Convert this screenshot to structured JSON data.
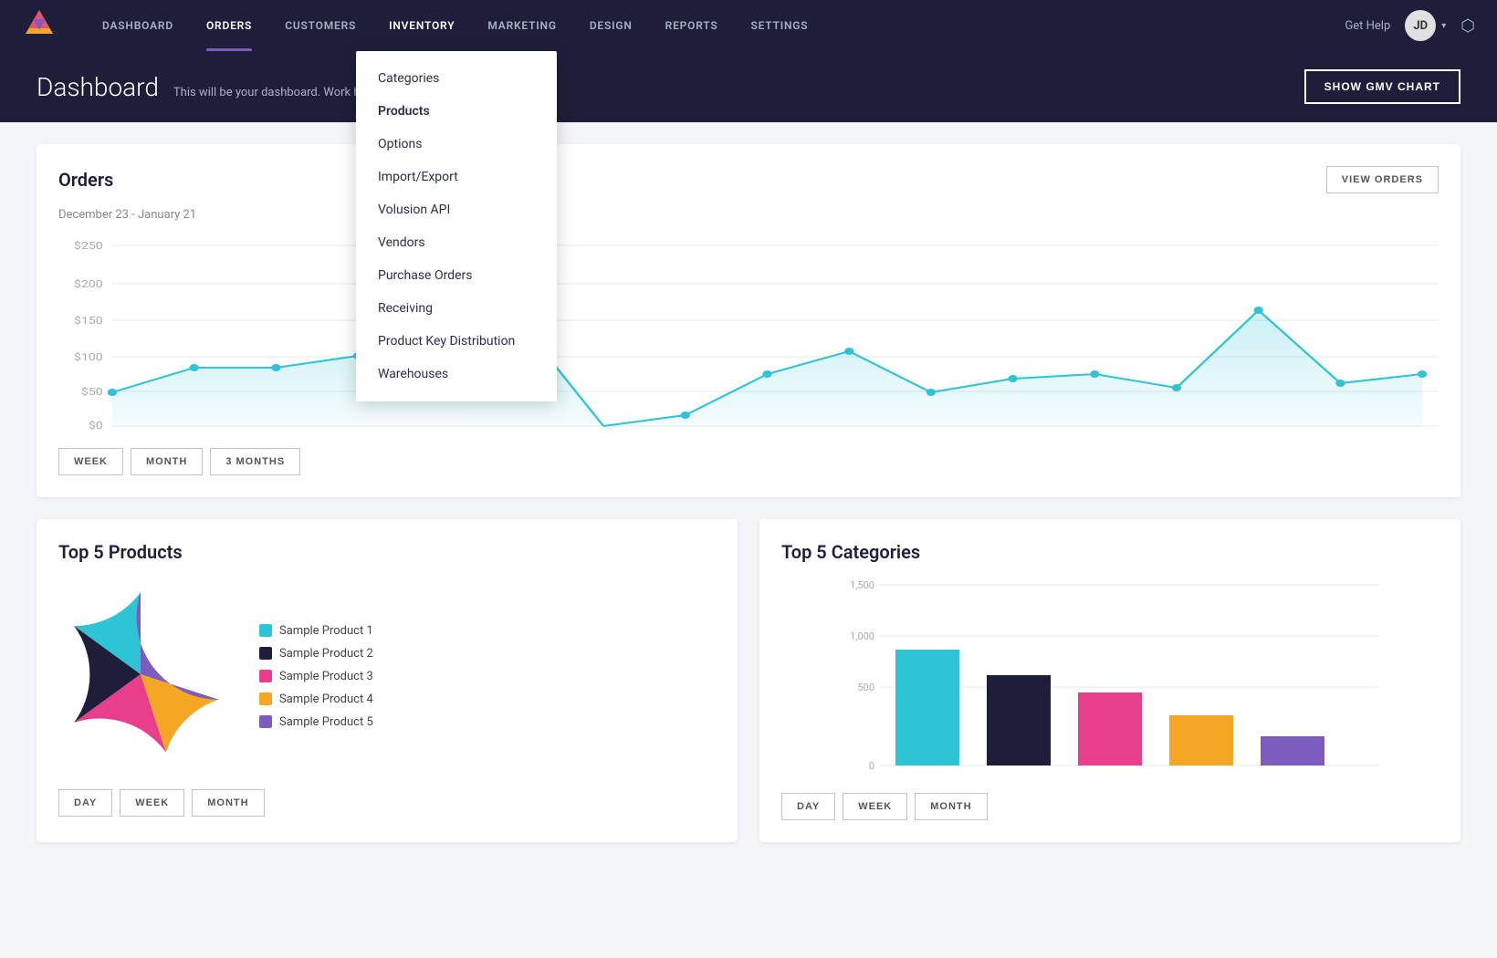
{
  "nav": {
    "items": [
      {
        "id": "dashboard",
        "label": "DASHBOARD",
        "active": false
      },
      {
        "id": "orders",
        "label": "ORDERS",
        "active": true
      },
      {
        "id": "customers",
        "label": "CUSTOMERS",
        "active": false
      },
      {
        "id": "inventory",
        "label": "INVENTORY",
        "active": false,
        "highlighted": true
      },
      {
        "id": "marketing",
        "label": "MARKETING",
        "active": false
      },
      {
        "id": "design",
        "label": "DESIGN",
        "active": false
      },
      {
        "id": "reports",
        "label": "REPORTS",
        "active": false
      },
      {
        "id": "settings",
        "label": "SETTINGS",
        "active": false
      }
    ],
    "get_help": "Get Help",
    "avatar_initials": "JD",
    "external_link_char": "⬡"
  },
  "header": {
    "title": "Dashboard",
    "subtitle": "This will be your dashboard. W...",
    "subtitle_full": "This will be your dashboard. Work hard and you'll get your first sale.",
    "gmv_button": "SHOW GMV CHART"
  },
  "orders_card": {
    "title": "Orders",
    "view_orders_btn": "VIEW ORDERS",
    "date_range": "December 23 - January 21",
    "y_labels": [
      "$250",
      "$200",
      "$150",
      "$100",
      "$50",
      "$0"
    ],
    "time_buttons": [
      "WEEK",
      "MONTH",
      "3 MONTHS"
    ]
  },
  "top_products": {
    "title": "Top 5 Products",
    "time_buttons": [
      "DAY",
      "WEEK",
      "MONTH"
    ],
    "legend": [
      {
        "label": "Sample Product 1",
        "color": "#2ec4d6"
      },
      {
        "label": "Sample Product 2",
        "color": "#1e1e3a"
      },
      {
        "label": "Sample Product 3",
        "color": "#e83e8c"
      },
      {
        "label": "Sample Product 4",
        "color": "#f5a623"
      },
      {
        "label": "Sample Product 5",
        "color": "#7c5cbf"
      }
    ],
    "pie_data": [
      {
        "label": "Sample Product 1",
        "color": "#2ec4d6",
        "value": 30
      },
      {
        "label": "Sample Product 2",
        "color": "#1e1e3a",
        "value": 25
      },
      {
        "label": "Sample Product 3",
        "color": "#e83e8c",
        "value": 20
      },
      {
        "label": "Sample Product 4",
        "color": "#f5a623",
        "value": 15
      },
      {
        "label": "Sample Product 5",
        "color": "#7c5cbf",
        "value": 10
      }
    ]
  },
  "top_categories": {
    "title": "Top 5 Categories",
    "time_buttons": [
      "DAY",
      "WEEK",
      "MONTH"
    ],
    "y_labels": [
      "1,500",
      "1,000",
      "500",
      "0"
    ],
    "bars": [
      {
        "color": "#2ec4d6",
        "height_pct": 0.65
      },
      {
        "color": "#1e1e3a",
        "height_pct": 0.5
      },
      {
        "color": "#e83e8c",
        "height_pct": 0.4
      },
      {
        "color": "#f5a623",
        "height_pct": 0.28
      },
      {
        "color": "#7c5cbf",
        "height_pct": 0.16
      }
    ]
  },
  "inventory_dropdown": {
    "items": [
      "Categories",
      "Products",
      "Options",
      "Import/Export",
      "Volusion API",
      "Vendors",
      "Purchase Orders",
      "Receiving",
      "Product Key Distribution",
      "Warehouses"
    ]
  },
  "colors": {
    "nav_bg": "#1e1e3a",
    "accent_purple": "#7c5cbf",
    "chart_line": "#2ec4d6",
    "body_bg": "#f4f5f9"
  }
}
